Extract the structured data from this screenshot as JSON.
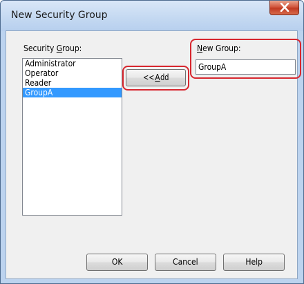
{
  "window": {
    "title": "New Security Group",
    "close_glyph": "x"
  },
  "security_group": {
    "label_before": "Security ",
    "label_mnemonic": "G",
    "label_after": "roup:",
    "items": [
      "Administrator",
      "Operator",
      "Reader",
      "GroupA"
    ],
    "selected": "GroupA"
  },
  "add_button": {
    "label_before": "<< ",
    "label_mnemonic": "A",
    "label_after": "dd"
  },
  "new_group": {
    "label_mnemonic": "N",
    "label_after": "ew Group:",
    "value": "GroupA"
  },
  "footer": {
    "ok_label": "OK",
    "cancel_label": "Cancel",
    "help_label": "Help"
  },
  "colors": {
    "highlight": "#d7262e",
    "selection": "#3399ff",
    "close_button": "#c13a22"
  },
  "icons": [
    "close-icon"
  ]
}
